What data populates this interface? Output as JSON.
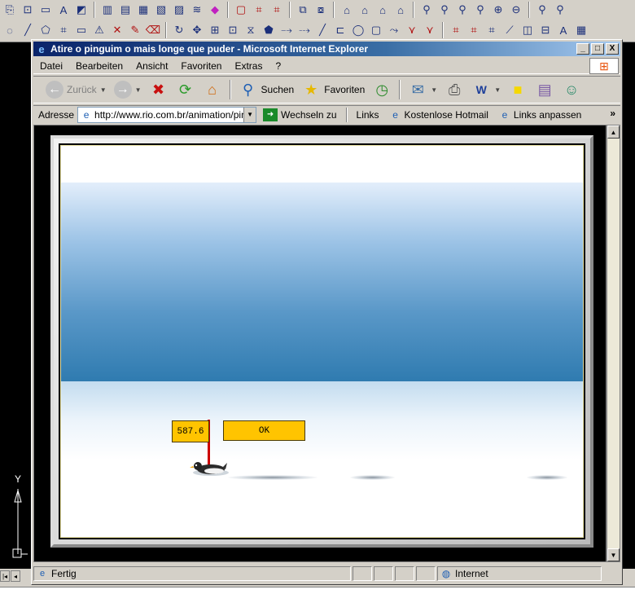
{
  "window": {
    "title": "Atire o pinguim o mais longe que puder - Microsoft Internet Explorer",
    "minimize": "_",
    "maximize": "□",
    "close": "X"
  },
  "menu": {
    "items": [
      "Datei",
      "Bearbeiten",
      "Ansicht",
      "Favoriten",
      "Extras",
      "?"
    ]
  },
  "toolbar": {
    "back_label": "Zurück",
    "search_label": "Suchen",
    "favorites_label": "Favoriten"
  },
  "address": {
    "label": "Adresse",
    "url": "http://www.rio.com.br/animation/pingu",
    "go_label": "Wechseln zu",
    "links_label": "Links",
    "links": [
      "Kostenlose Hotmail",
      "Links anpassen"
    ],
    "more": "»"
  },
  "game": {
    "distance": "587.6",
    "ok_label": "OK"
  },
  "status": {
    "text": "Fertig",
    "zone": "Internet"
  },
  "cad": {
    "axis_label": "Y"
  },
  "icons": {
    "globe": "globe-icon",
    "penguin": "penguin-icon",
    "windows_logo": "windows-logo-icon"
  },
  "colors": {
    "title_bar": "#0a246a",
    "box_fill": "#ffc400",
    "pole": "#cc0000",
    "sky_dark": "#2f7bb0"
  }
}
